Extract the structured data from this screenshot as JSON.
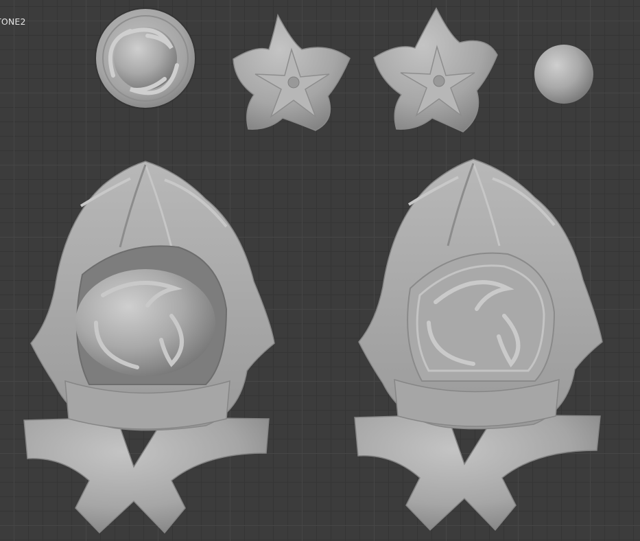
{
  "viewport": {
    "object_label": "TONE2",
    "background_color": "#3c3c3c",
    "grid_major_color": "#464646",
    "grid_minor_color": "#353535",
    "model_color": "#a9a9a9"
  }
}
